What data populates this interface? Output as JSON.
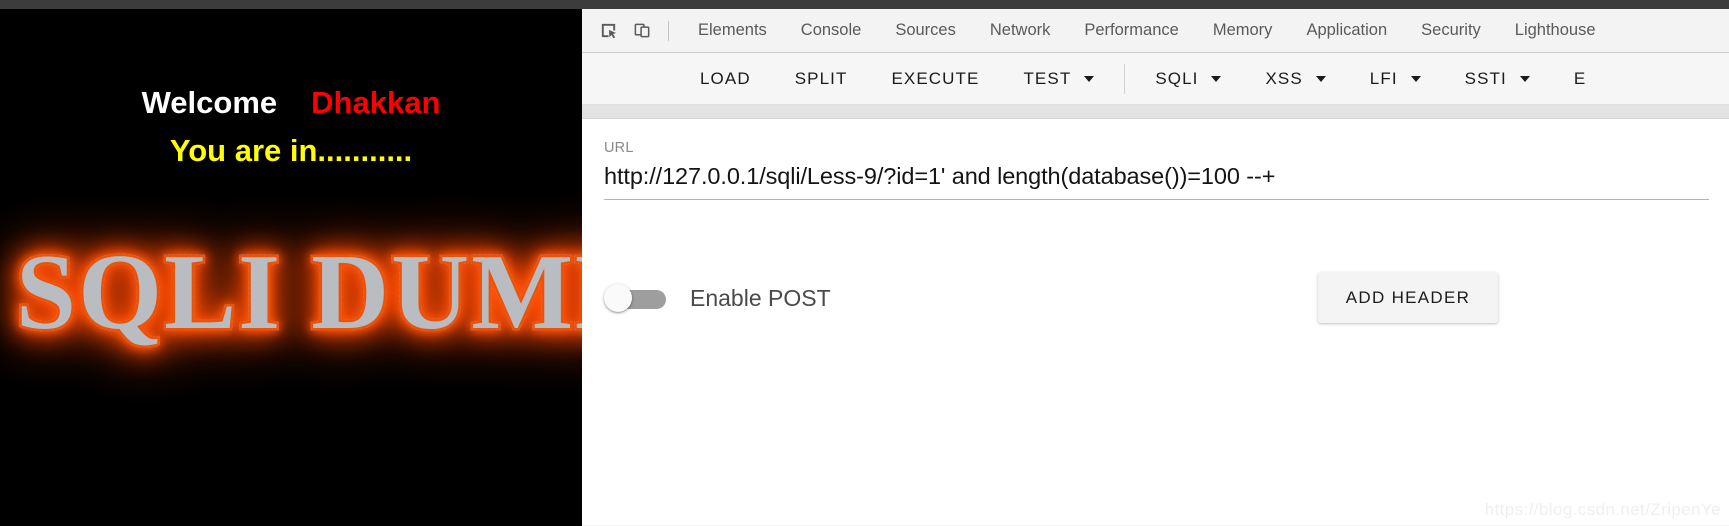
{
  "page": {
    "welcome_text": "Welcome",
    "username": "Dhakkan",
    "status_text": "You are in...........",
    "logo_text": "SQLI DUMB",
    "colors": {
      "background": "#000000",
      "welcome": "#ffffff",
      "username": "#ff0000",
      "status": "#ffff00",
      "logo_glow": "#e8540d"
    }
  },
  "devtools": {
    "icons": [
      {
        "name": "inspect-element-icon",
        "label": "Inspect element"
      },
      {
        "name": "device-toolbar-icon",
        "label": "Toggle device toolbar"
      }
    ],
    "tabs": [
      {
        "label": "Elements"
      },
      {
        "label": "Console"
      },
      {
        "label": "Sources"
      },
      {
        "label": "Network"
      },
      {
        "label": "Performance"
      },
      {
        "label": "Memory"
      },
      {
        "label": "Application"
      },
      {
        "label": "Security"
      },
      {
        "label": "Lighthouse"
      }
    ],
    "active_tab": ""
  },
  "app": {
    "toolbar": [
      {
        "label": "LOAD",
        "caret": false,
        "sep_after": false
      },
      {
        "label": "SPLIT",
        "caret": false,
        "sep_after": false
      },
      {
        "label": "EXECUTE",
        "caret": false,
        "sep_after": false
      },
      {
        "label": "TEST",
        "caret": true,
        "sep_after": true
      },
      {
        "label": "SQLI",
        "caret": true,
        "sep_after": false
      },
      {
        "label": "XSS",
        "caret": true,
        "sep_after": false
      },
      {
        "label": "LFI",
        "caret": true,
        "sep_after": false
      },
      {
        "label": "SSTI",
        "caret": true,
        "sep_after": false
      },
      {
        "label": "E",
        "caret": false,
        "sep_after": false
      }
    ],
    "url": {
      "label": "URL",
      "value": "http://127.0.0.1/sqli/Less-9/?id=1'  and length(database())=100  --+",
      "placeholder": "URL"
    },
    "post_toggle": {
      "label": "Enable POST",
      "enabled": false
    },
    "add_header_label": "ADD HEADER"
  },
  "watermark": {
    "text": "https://blog.csdn.net/ZripenYe"
  }
}
